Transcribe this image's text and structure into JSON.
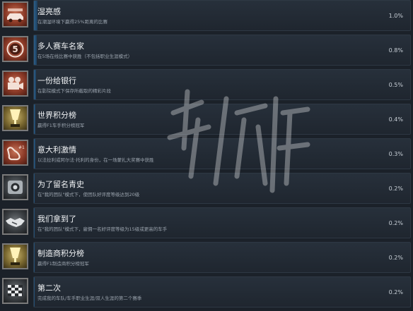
{
  "achievements": [
    {
      "title": "湿亮感",
      "desc": "在潮湿环境下赢得25%距离的比赛",
      "percent": "1.0%",
      "progress": 0.01,
      "icon": "car-rain-icon",
      "tone": "red"
    },
    {
      "title": "多人赛车名家",
      "desc": "在5场在线比赛中获胜（不包括职业生涯模式）",
      "percent": "0.8%",
      "progress": 0.008,
      "icon": "number-five-badge-icon",
      "tone": "red"
    },
    {
      "title": "一份给银行",
      "desc": "在影院模式下保存所截取的精彩片段",
      "percent": "0.5%",
      "progress": 0.005,
      "icon": "film-camera-icon",
      "tone": "red"
    },
    {
      "title": "世界积分榜",
      "desc": "赢得F1车手积分榜冠军",
      "percent": "0.4%",
      "progress": 0.004,
      "icon": "gold-trophy-icon",
      "tone": "gold"
    },
    {
      "title": "意大利激情",
      "desc": "以法拉利或阿尔法·托利的身份，在一场蒙扎大奖赛中获胜",
      "percent": "0.3%",
      "progress": 0.003,
      "icon": "monza-track-icon",
      "tone": "red"
    },
    {
      "title": "为了留名青史",
      "desc": "在\"我的团队\"模式下，使团队好评度等级达到20级",
      "percent": "0.2%",
      "progress": 0.002,
      "icon": "steering-wheel-icon",
      "tone": "dark"
    },
    {
      "title": "我们拿到了",
      "desc": "在\"我的团队\"模式下，雇佣一名好评度等级为15级或更高的车手",
      "percent": "0.2%",
      "progress": 0.002,
      "icon": "handshake-icon",
      "tone": "dark"
    },
    {
      "title": "制造商积分榜",
      "desc": "赢得F1制造商积分榜冠军",
      "percent": "0.2%",
      "progress": 0.002,
      "icon": "gold-trophy-icon",
      "tone": "gold"
    },
    {
      "title": "第二次",
      "desc": "完成我的车队/车手职业生涯/双人生涯的第二个赛季",
      "percent": "0.2%",
      "progress": 0.002,
      "icon": "checkered-flag-icon",
      "tone": "dark"
    }
  ],
  "watermark": {
    "text": "游侠网"
  }
}
